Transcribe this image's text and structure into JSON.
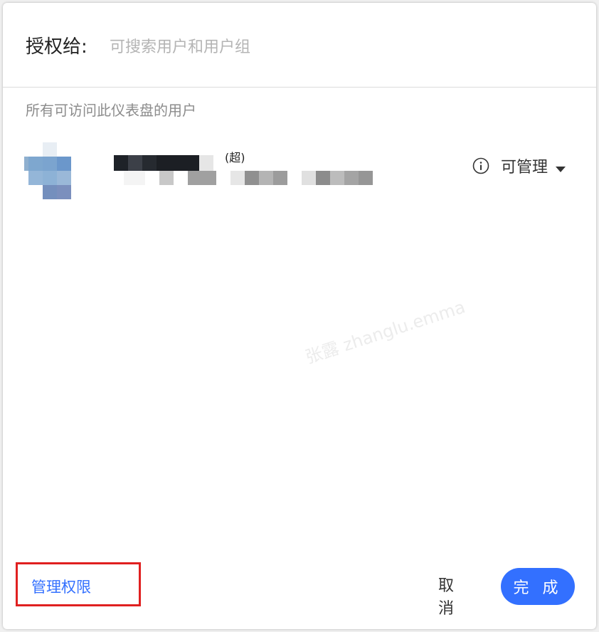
{
  "dialog": {
    "grant": {
      "label": "授权给:",
      "placeholder": "可搜索用户和用户组",
      "value": ""
    },
    "section_title": "所有可访问此仪表盘的用户",
    "users": [
      {
        "name_tail": "(超)",
        "permission": "可管理",
        "info_icon": "info-circle-icon",
        "dropdown_icon": "caret-down-icon"
      }
    ],
    "watermark": "张露 zhanglu.emma",
    "footer": {
      "manage_link": "管理权限",
      "cancel_label": "取 消",
      "done_label": "完 成"
    }
  },
  "colors": {
    "accent": "#3370ff",
    "highlight": "#e02020",
    "muted_text": "#8c8c8c",
    "placeholder": "#b4b4b4"
  }
}
